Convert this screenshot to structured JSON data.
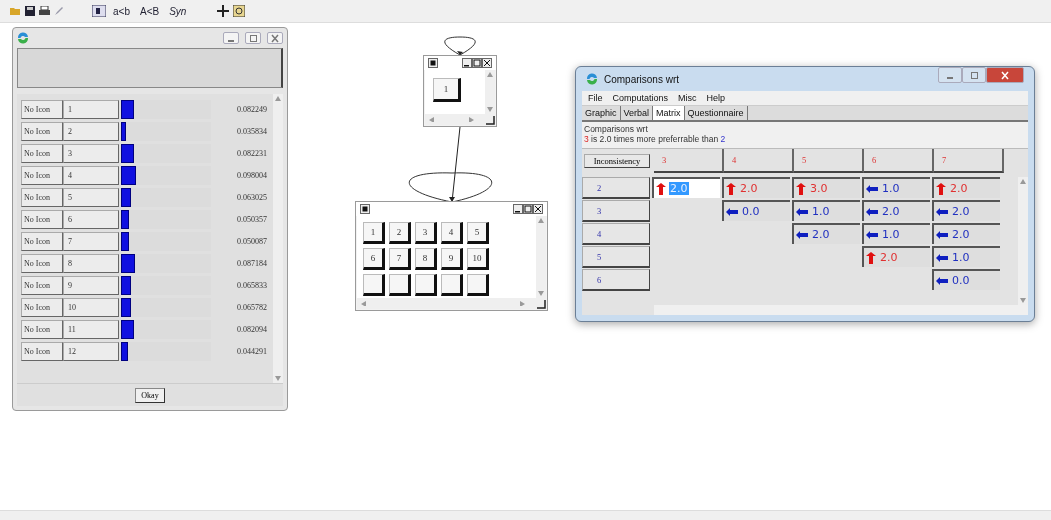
{
  "toolbar": {
    "labels": [
      "a<b",
      "A<B",
      "Syn"
    ]
  },
  "priorities": {
    "rows": [
      {
        "icon_label": "No Icon",
        "name": "1",
        "value": "0.082249",
        "level": 0.14
      },
      {
        "icon_label": "No Icon",
        "name": "2",
        "value": "0.035834",
        "level": 0.06
      },
      {
        "icon_label": "No Icon",
        "name": "3",
        "value": "0.082231",
        "level": 0.14
      },
      {
        "icon_label": "No Icon",
        "name": "4",
        "value": "0.098004",
        "level": 0.17
      },
      {
        "icon_label": "No Icon",
        "name": "5",
        "value": "0.063025",
        "level": 0.11
      },
      {
        "icon_label": "No Icon",
        "name": "6",
        "value": "0.050357",
        "level": 0.09
      },
      {
        "icon_label": "No Icon",
        "name": "7",
        "value": "0.050087",
        "level": 0.09
      },
      {
        "icon_label": "No Icon",
        "name": "8",
        "value": "0.087184",
        "level": 0.15
      },
      {
        "icon_label": "No Icon",
        "name": "9",
        "value": "0.065833",
        "level": 0.11
      },
      {
        "icon_label": "No Icon",
        "name": "10",
        "value": "0.065782",
        "level": 0.11
      },
      {
        "icon_label": "No Icon",
        "name": "11",
        "value": "0.082094",
        "level": 0.14
      },
      {
        "icon_label": "No Icon",
        "name": "12",
        "value": "0.044291",
        "level": 0.08
      }
    ],
    "button": "Okay"
  },
  "nodes": [
    {
      "buttons": [
        "1"
      ]
    },
    {
      "buttons": [
        "1",
        "2",
        "3",
        "4",
        "5",
        "6",
        "7",
        "8",
        "9",
        "10"
      ]
    }
  ],
  "comparisons": {
    "title": "Comparisons wrt",
    "menu": [
      "File",
      "Computations",
      "Misc",
      "Help"
    ],
    "tabs": [
      {
        "label": "Graphic",
        "selected": false
      },
      {
        "label": "Verbal",
        "selected": false
      },
      {
        "label": "Matrix",
        "selected": true
      },
      {
        "label": "Questionnaire",
        "selected": false
      }
    ],
    "info": {
      "heading": "Comparisons wrt",
      "subject": "3",
      "text": "is 2.0 times more preferrable than",
      "object": "2"
    },
    "matrix": {
      "button": "Inconsistency",
      "columns": [
        "3",
        "4",
        "5",
        "6",
        "7"
      ],
      "rows": [
        {
          "label": "2",
          "cells": [
            {
              "kind": "up",
              "value": "2.0",
              "selected": true
            },
            {
              "kind": "up",
              "value": "2.0",
              "selected": false
            },
            {
              "kind": "up",
              "value": "3.0",
              "selected": false
            },
            {
              "kind": "left",
              "value": "1.0",
              "selected": false
            },
            {
              "kind": "up",
              "value": "2.0",
              "selected": false
            }
          ]
        },
        {
          "label": "3",
          "cells": [
            null,
            {
              "kind": "left",
              "value": "0.0",
              "selected": false
            },
            {
              "kind": "left",
              "value": "1.0",
              "selected": false
            },
            {
              "kind": "left",
              "value": "2.0",
              "selected": false
            },
            {
              "kind": "left",
              "value": "2.0",
              "selected": false
            }
          ]
        },
        {
          "label": "4",
          "cells": [
            null,
            null,
            {
              "kind": "left",
              "value": "2.0",
              "selected": false
            },
            {
              "kind": "left",
              "value": "1.0",
              "selected": false
            },
            {
              "kind": "left",
              "value": "2.0",
              "selected": false
            }
          ]
        },
        {
          "label": "5",
          "cells": [
            null,
            null,
            null,
            {
              "kind": "up",
              "value": "2.0",
              "selected": false
            },
            {
              "kind": "left",
              "value": "1.0",
              "selected": false
            }
          ]
        },
        {
          "label": "6",
          "cells": [
            null,
            null,
            null,
            null,
            {
              "kind": "left",
              "value": "0.0",
              "selected": false
            }
          ]
        }
      ]
    }
  }
}
